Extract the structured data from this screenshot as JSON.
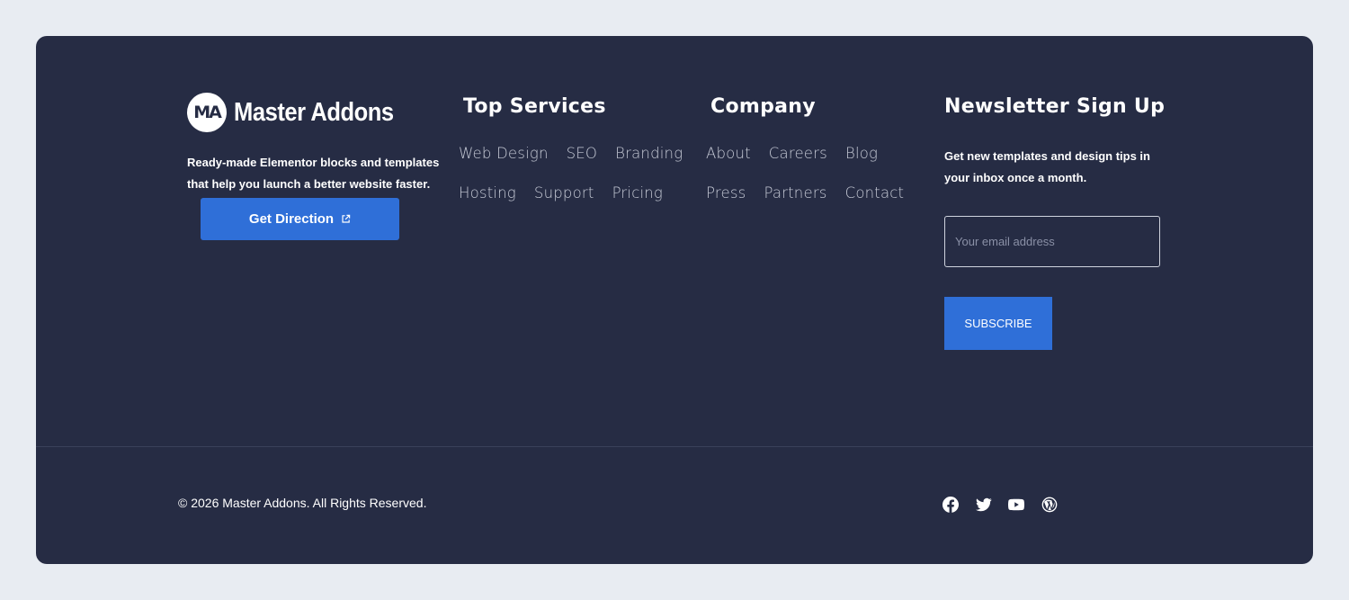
{
  "brand": {
    "logo_mark": "MA",
    "name": "Master Addons"
  },
  "about": {
    "text": "Ready-made Elementor blocks and templates that help you launch a better website faster.",
    "cta_label": "Get Direction",
    "cta_icon": "external-link-icon"
  },
  "services": {
    "heading": "Top Services",
    "rows": [
      [
        "Web Design",
        "SEO",
        "Branding"
      ],
      [
        "Hosting",
        "Support",
        "Pricing"
      ]
    ]
  },
  "company": {
    "heading": "Company",
    "rows": [
      [
        "About",
        "Careers",
        "Blog"
      ],
      [
        "Press",
        "Partners",
        "Contact"
      ]
    ]
  },
  "newsletter": {
    "heading": "Newsletter Sign Up",
    "text": "Get new templates and design tips in your inbox once a month.",
    "email_placeholder": "Your email address",
    "email_value": "",
    "subscribe_label": "SUBSCRIBE"
  },
  "bottom": {
    "copyright": "© 2026 Master Addons. All Rights Reserved.",
    "social": [
      "facebook-icon",
      "twitter-icon",
      "youtube-icon",
      "wordpress-icon"
    ]
  },
  "colors": {
    "background": "#e8ecf2",
    "footer_bg": "#262c44",
    "accent": "#2f6fd8",
    "link_text": "#c6cad6"
  }
}
